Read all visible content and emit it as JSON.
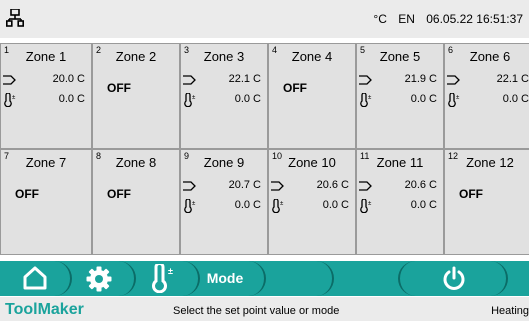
{
  "header": {
    "network_icon": "network-icon",
    "unit": "°C",
    "language": "EN",
    "datetime": "06.05.22 16:51:37"
  },
  "zones": [
    {
      "number": "1",
      "name": "Zone 1",
      "status": "",
      "setpoint": "20.0 C",
      "offset": "0.0 C"
    },
    {
      "number": "2",
      "name": "Zone 2",
      "status": "OFF",
      "setpoint": "",
      "offset": ""
    },
    {
      "number": "3",
      "name": "Zone 3",
      "status": "",
      "setpoint": "22.1 C",
      "offset": "0.0 C"
    },
    {
      "number": "4",
      "name": "Zone 4",
      "status": "OFF",
      "setpoint": "",
      "offset": ""
    },
    {
      "number": "5",
      "name": "Zone 5",
      "status": "",
      "setpoint": "21.9 C",
      "offset": "0.0 C"
    },
    {
      "number": "6",
      "name": "Zone 6",
      "status": "",
      "setpoint": "22.1 C",
      "offset": "0.0 C"
    },
    {
      "number": "7",
      "name": "Zone 7",
      "status": "OFF",
      "setpoint": "",
      "offset": ""
    },
    {
      "number": "8",
      "name": "Zone 8",
      "status": "OFF",
      "setpoint": "",
      "offset": ""
    },
    {
      "number": "9",
      "name": "Zone 9",
      "status": "",
      "setpoint": "20.7 C",
      "offset": "0.0 C"
    },
    {
      "number": "10",
      "name": "Zone 10",
      "status": "",
      "setpoint": "20.6 C",
      "offset": "0.0 C"
    },
    {
      "number": "11",
      "name": "Zone 11",
      "status": "",
      "setpoint": "20.6 C",
      "offset": "0.0 C"
    },
    {
      "number": "12",
      "name": "Zone 12",
      "status": "OFF",
      "setpoint": "",
      "offset": ""
    }
  ],
  "toolbar": {
    "home_icon": "home-icon",
    "settings_icon": "gear-icon",
    "thermometer_icon": "thermometer-icon",
    "mode_label": "Mode",
    "power_icon": "power-icon",
    "accent_color": "#1aa39c"
  },
  "statusbar": {
    "brand": "ToolMaker",
    "message": "Select the set point value or mode",
    "mode": "Heating"
  }
}
